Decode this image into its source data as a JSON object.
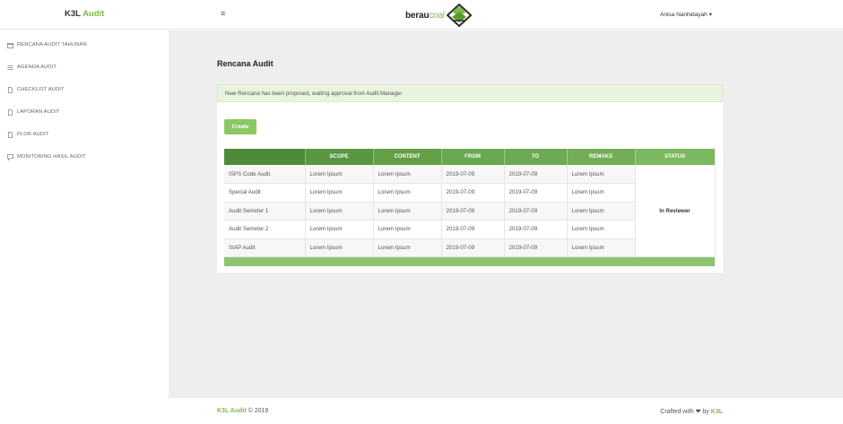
{
  "brand": {
    "name": "K3L",
    "accent": "Audit"
  },
  "logo": {
    "word_part1": "berau",
    "word_part2": "coal"
  },
  "header": {
    "user_name": "Anisa Nanhidayah",
    "menu_icon": "hamburger-icon"
  },
  "sidebar": {
    "items": [
      {
        "label": "RENCANA AUDIT TAHUNAN",
        "icon": "calendar-icon"
      },
      {
        "label": "AGENDA AUDIT",
        "icon": "list-icon"
      },
      {
        "label": "CHECKLIST AUDIT",
        "icon": "document-icon"
      },
      {
        "label": "LAPORAN AUDIT",
        "icon": "document-icon"
      },
      {
        "label": "PLOR AUDIT",
        "icon": "document-icon"
      },
      {
        "label": "MONITORING HASIL AUDIT",
        "icon": "chat-icon"
      }
    ]
  },
  "main": {
    "title": "Rencana Audit",
    "alert": "New Rencana has been proposed, waiting approval from Audit Manager",
    "create_label": "Create",
    "table": {
      "headers": [
        "",
        "SCOPE",
        "CONTENT",
        "FROM",
        "TO",
        "REMAKS",
        "STATUS"
      ],
      "header_colors": [
        "#4e8a3a",
        "#5a9641",
        "#649f47",
        "#6aa84f",
        "#6ea953",
        "#73ae57",
        "#7cb85f"
      ],
      "rows": [
        [
          "ISPS Code Audit",
          "Lorem Ipsum",
          "Lorem Ipsum",
          "2019-07-09",
          "2019-07-09",
          "Lorem Ipsum"
        ],
        [
          "Special Audit",
          "Lorem Ipsum",
          "Lorem Ipsum",
          "2019-07-09",
          "2019-07-09",
          "Lorem Ipsum"
        ],
        [
          "Audit Semeter 1",
          "Lorem Ipsum",
          "Lorem Ipsum",
          "2019-07-09",
          "2019-07-09",
          "Lorem Ipsum"
        ],
        [
          "Audit Semeter 2",
          "Lorem Ipsum",
          "Lorem Ipsum",
          "2019-07-09",
          "2019-07-09",
          "Lorem Ipsum"
        ],
        [
          "SIAP Audit",
          "Lorem Ipsum",
          "Lorem Ipsum",
          "2019-07-09",
          "2019-07-09",
          "Lorem Ipsum"
        ]
      ],
      "status": "In Reviewer"
    }
  },
  "footer": {
    "brand": "K3L Audit",
    "copyright": "© 2019",
    "crafted": "Crafted with",
    "by": "by",
    "by_brand": "K3L"
  }
}
